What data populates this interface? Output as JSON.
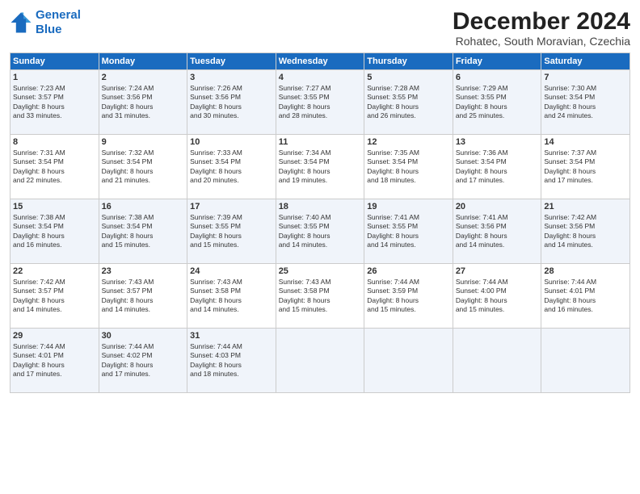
{
  "logo": {
    "line1": "General",
    "line2": "Blue"
  },
  "title": "December 2024",
  "subtitle": "Rohatec, South Moravian, Czechia",
  "days_of_week": [
    "Sunday",
    "Monday",
    "Tuesday",
    "Wednesday",
    "Thursday",
    "Friday",
    "Saturday"
  ],
  "weeks": [
    [
      {
        "day": "1",
        "info": "Sunrise: 7:23 AM\nSunset: 3:57 PM\nDaylight: 8 hours\nand 33 minutes."
      },
      {
        "day": "2",
        "info": "Sunrise: 7:24 AM\nSunset: 3:56 PM\nDaylight: 8 hours\nand 31 minutes."
      },
      {
        "day": "3",
        "info": "Sunrise: 7:26 AM\nSunset: 3:56 PM\nDaylight: 8 hours\nand 30 minutes."
      },
      {
        "day": "4",
        "info": "Sunrise: 7:27 AM\nSunset: 3:55 PM\nDaylight: 8 hours\nand 28 minutes."
      },
      {
        "day": "5",
        "info": "Sunrise: 7:28 AM\nSunset: 3:55 PM\nDaylight: 8 hours\nand 26 minutes."
      },
      {
        "day": "6",
        "info": "Sunrise: 7:29 AM\nSunset: 3:55 PM\nDaylight: 8 hours\nand 25 minutes."
      },
      {
        "day": "7",
        "info": "Sunrise: 7:30 AM\nSunset: 3:54 PM\nDaylight: 8 hours\nand 24 minutes."
      }
    ],
    [
      {
        "day": "8",
        "info": "Sunrise: 7:31 AM\nSunset: 3:54 PM\nDaylight: 8 hours\nand 22 minutes."
      },
      {
        "day": "9",
        "info": "Sunrise: 7:32 AM\nSunset: 3:54 PM\nDaylight: 8 hours\nand 21 minutes."
      },
      {
        "day": "10",
        "info": "Sunrise: 7:33 AM\nSunset: 3:54 PM\nDaylight: 8 hours\nand 20 minutes."
      },
      {
        "day": "11",
        "info": "Sunrise: 7:34 AM\nSunset: 3:54 PM\nDaylight: 8 hours\nand 19 minutes."
      },
      {
        "day": "12",
        "info": "Sunrise: 7:35 AM\nSunset: 3:54 PM\nDaylight: 8 hours\nand 18 minutes."
      },
      {
        "day": "13",
        "info": "Sunrise: 7:36 AM\nSunset: 3:54 PM\nDaylight: 8 hours\nand 17 minutes."
      },
      {
        "day": "14",
        "info": "Sunrise: 7:37 AM\nSunset: 3:54 PM\nDaylight: 8 hours\nand 17 minutes."
      }
    ],
    [
      {
        "day": "15",
        "info": "Sunrise: 7:38 AM\nSunset: 3:54 PM\nDaylight: 8 hours\nand 16 minutes."
      },
      {
        "day": "16",
        "info": "Sunrise: 7:38 AM\nSunset: 3:54 PM\nDaylight: 8 hours\nand 15 minutes."
      },
      {
        "day": "17",
        "info": "Sunrise: 7:39 AM\nSunset: 3:55 PM\nDaylight: 8 hours\nand 15 minutes."
      },
      {
        "day": "18",
        "info": "Sunrise: 7:40 AM\nSunset: 3:55 PM\nDaylight: 8 hours\nand 14 minutes."
      },
      {
        "day": "19",
        "info": "Sunrise: 7:41 AM\nSunset: 3:55 PM\nDaylight: 8 hours\nand 14 minutes."
      },
      {
        "day": "20",
        "info": "Sunrise: 7:41 AM\nSunset: 3:56 PM\nDaylight: 8 hours\nand 14 minutes."
      },
      {
        "day": "21",
        "info": "Sunrise: 7:42 AM\nSunset: 3:56 PM\nDaylight: 8 hours\nand 14 minutes."
      }
    ],
    [
      {
        "day": "22",
        "info": "Sunrise: 7:42 AM\nSunset: 3:57 PM\nDaylight: 8 hours\nand 14 minutes."
      },
      {
        "day": "23",
        "info": "Sunrise: 7:43 AM\nSunset: 3:57 PM\nDaylight: 8 hours\nand 14 minutes."
      },
      {
        "day": "24",
        "info": "Sunrise: 7:43 AM\nSunset: 3:58 PM\nDaylight: 8 hours\nand 14 minutes."
      },
      {
        "day": "25",
        "info": "Sunrise: 7:43 AM\nSunset: 3:58 PM\nDaylight: 8 hours\nand 15 minutes."
      },
      {
        "day": "26",
        "info": "Sunrise: 7:44 AM\nSunset: 3:59 PM\nDaylight: 8 hours\nand 15 minutes."
      },
      {
        "day": "27",
        "info": "Sunrise: 7:44 AM\nSunset: 4:00 PM\nDaylight: 8 hours\nand 15 minutes."
      },
      {
        "day": "28",
        "info": "Sunrise: 7:44 AM\nSunset: 4:01 PM\nDaylight: 8 hours\nand 16 minutes."
      }
    ],
    [
      {
        "day": "29",
        "info": "Sunrise: 7:44 AM\nSunset: 4:01 PM\nDaylight: 8 hours\nand 17 minutes."
      },
      {
        "day": "30",
        "info": "Sunrise: 7:44 AM\nSunset: 4:02 PM\nDaylight: 8 hours\nand 17 minutes."
      },
      {
        "day": "31",
        "info": "Sunrise: 7:44 AM\nSunset: 4:03 PM\nDaylight: 8 hours\nand 18 minutes."
      },
      {
        "day": "",
        "info": ""
      },
      {
        "day": "",
        "info": ""
      },
      {
        "day": "",
        "info": ""
      },
      {
        "day": "",
        "info": ""
      }
    ]
  ]
}
